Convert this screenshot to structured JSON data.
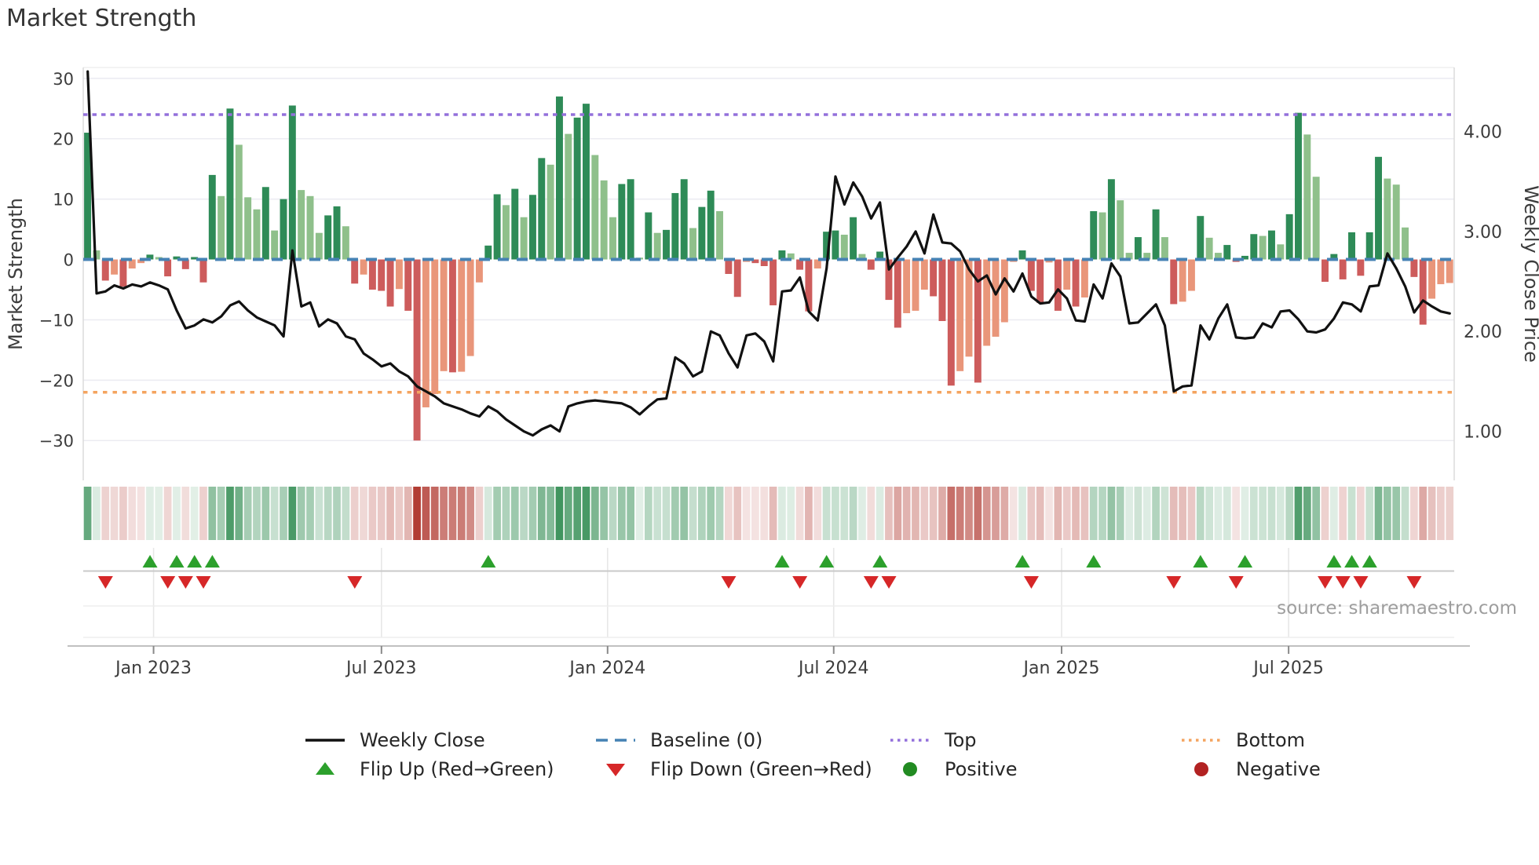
{
  "title": "Market Strength",
  "source_note": "source: sharemaestro.com",
  "axes": {
    "left": {
      "title": "Market Strength",
      "tick_values": [
        30,
        20,
        10,
        0,
        -10,
        -20,
        -30
      ],
      "tick_labels": [
        "30",
        "20",
        "10",
        "0",
        "−10",
        "−20",
        "−30"
      ]
    },
    "right": {
      "title": "Weekly Close Price",
      "tick_values": [
        4,
        3,
        2,
        1
      ],
      "tick_labels": [
        "4.00",
        "3.00",
        "2.00",
        "1.00"
      ]
    },
    "x": {
      "tick_labels": [
        "Jan 2023",
        "Jul 2023",
        "Jan 2024",
        "Jul 2024",
        "Jan 2025",
        "Jul 2025"
      ],
      "tick_weeks": [
        7.4,
        33.0,
        58.4,
        83.8,
        109.4,
        134.9
      ]
    }
  },
  "legend": {
    "items": [
      {
        "label": "Weekly Close",
        "swatch": "line",
        "color": "#111111"
      },
      {
        "label": "Baseline (0)",
        "swatch": "dashed-line",
        "color": "#4682b4"
      },
      {
        "label": "Top",
        "swatch": "dotted-line",
        "color": "#9370db"
      },
      {
        "label": "Bottom",
        "swatch": "dotted-line",
        "color": "#f4a460"
      },
      {
        "label": "Flip Up (Red→Green)",
        "swatch": "triangle-up",
        "color": "#2ca02c"
      },
      {
        "label": "Flip Down (Green→Red)",
        "swatch": "triangle-down",
        "color": "#d62728"
      },
      {
        "label": "Positive",
        "swatch": "circle",
        "color": "#228b22"
      },
      {
        "label": "Negative",
        "swatch": "circle",
        "color": "#b22222"
      }
    ]
  },
  "chart_data": {
    "type": "bar+line",
    "title": "Market Strength",
    "ylabel_left": "Market Strength",
    "ylabel_right": "Weekly Close Price",
    "n_weeks": 154,
    "baseline": 0,
    "top_level": 24,
    "bottom_level": -22,
    "ylim_left": [
      -36.6,
      31.8
    ],
    "ylim_right": [
      0.51,
      4.64
    ],
    "grid": "horizontal",
    "series": [
      {
        "name": "Market Strength",
        "type": "bar",
        "axis": "left",
        "values": [
          21,
          1.5,
          -3.5,
          -2.5,
          -4.5,
          -1.5,
          -0.6,
          0.8,
          0.4,
          -2.8,
          0.5,
          -1.6,
          0.4,
          -3.8,
          14,
          10.5,
          25,
          19,
          10.3,
          8.3,
          12,
          4.8,
          10,
          25.5,
          11.5,
          10.5,
          4.4,
          7.3,
          8.8,
          5.5,
          -4,
          -2.5,
          -5,
          -5.2,
          -7.8,
          -4.9,
          -8.5,
          -30,
          -24.5,
          -22.3,
          -18.5,
          -18.7,
          -18.6,
          -16,
          -3.8,
          2.3,
          10.8,
          9,
          11.7,
          7,
          10.7,
          16.8,
          15.7,
          27,
          20.8,
          23.5,
          25.8,
          17.3,
          13.1,
          7,
          12.5,
          13.3,
          0.3,
          7.8,
          4.4,
          4.9,
          11,
          13.3,
          5.2,
          8.7,
          11.4,
          8,
          -2.4,
          -6.2,
          -0.4,
          -0.6,
          -1.1,
          -7.6,
          1.5,
          1,
          -1.7,
          -8.6,
          -1.5,
          4.6,
          4.8,
          4.1,
          7,
          0.9,
          -1.7,
          1.3,
          -6.7,
          -11.3,
          -8.9,
          -8.5,
          -5,
          -6.1,
          -10.2,
          -20.9,
          -18.5,
          -16.1,
          -20.4,
          -14.3,
          -12.8,
          -10.4,
          -0.4,
          1.5,
          -5.2,
          -7.2,
          -0.5,
          -8.5,
          -5,
          -7.8,
          -6.3,
          8,
          7.8,
          13.3,
          9.8,
          1.1,
          3.7,
          1.1,
          8.3,
          3.7,
          -7.4,
          -7,
          -5.2,
          7.2,
          3.6,
          1.1,
          2.4,
          -0.4,
          0.6,
          4.2,
          3.9,
          4.8,
          2.5,
          7.5,
          24.3,
          20.7,
          13.7,
          -3.7,
          0.9,
          -3.3,
          4.5,
          -2.7,
          4.5,
          17,
          13.4,
          12.4,
          5.3,
          -2.9,
          -10.8,
          -6.5,
          -4.1,
          -3.9
        ]
      },
      {
        "name": "Weekly Close",
        "type": "line",
        "axis": "right",
        "values": [
          4.6,
          2.38,
          2.4,
          2.46,
          2.43,
          2.47,
          2.45,
          2.49,
          2.46,
          2.42,
          2.21,
          2.03,
          2.06,
          2.12,
          2.09,
          2.15,
          2.26,
          2.3,
          2.21,
          2.14,
          2.1,
          2.06,
          1.95,
          2.81,
          2.25,
          2.29,
          2.05,
          2.12,
          2.08,
          1.95,
          1.92,
          1.78,
          1.72,
          1.65,
          1.68,
          1.6,
          1.55,
          1.45,
          1.4,
          1.35,
          1.28,
          1.25,
          1.22,
          1.18,
          1.15,
          1.25,
          1.2,
          1.12,
          1.06,
          1,
          0.96,
          1.02,
          1.06,
          1,
          1.25,
          1.28,
          1.3,
          1.31,
          1.3,
          1.29,
          1.28,
          1.24,
          1.17,
          1.25,
          1.32,
          1.33,
          1.74,
          1.68,
          1.55,
          1.6,
          2,
          1.96,
          1.78,
          1.64,
          1.96,
          1.98,
          1.9,
          1.7,
          2.4,
          2.41,
          2.54,
          2.2,
          2.11,
          2.63,
          3.55,
          3.27,
          3.49,
          3.35,
          3.13,
          3.29,
          2.62,
          2.74,
          2.85,
          3,
          2.78,
          3.17,
          2.89,
          2.88,
          2.8,
          2.62,
          2.5,
          2.56,
          2.37,
          2.53,
          2.4,
          2.58,
          2.35,
          2.28,
          2.29,
          2.42,
          2.33,
          2.11,
          2.1,
          2.47,
          2.33,
          2.68,
          2.55,
          2.08,
          2.09,
          2.18,
          2.27,
          2.06,
          1.4,
          1.45,
          1.46,
          2.06,
          1.92,
          2.13,
          2.27,
          1.94,
          1.93,
          1.94,
          2.08,
          2.04,
          2.2,
          2.21,
          2.12,
          2,
          1.99,
          2.02,
          2.13,
          2.29,
          2.27,
          2.2,
          2.45,
          2.46,
          2.78,
          2.63,
          2.45,
          2.19,
          2.31,
          2.25,
          2.2,
          2.18
        ]
      }
    ],
    "flip_up_weeks": [
      7,
      10,
      12,
      14,
      45,
      78,
      83,
      89,
      105,
      113,
      125,
      130,
      140,
      142,
      144
    ],
    "flip_down_weeks": [
      2,
      9,
      11,
      13,
      30,
      72,
      80,
      88,
      90,
      106,
      122,
      129,
      139,
      141,
      143,
      149
    ],
    "colors": {
      "bar_pos_rising": "#2e8b57",
      "bar_pos_falling": "#8fc08b",
      "bar_neg_falling": "#cd5c5c",
      "bar_neg_rising": "#e9967a",
      "line": "#111111",
      "baseline": "#4682b4",
      "top": "#9370db",
      "bottom": "#f4a460",
      "flip_up": "#2ca02c",
      "flip_down": "#d62728",
      "heat_pos": "#2f8b50",
      "heat_neg": "#b23c33"
    }
  }
}
